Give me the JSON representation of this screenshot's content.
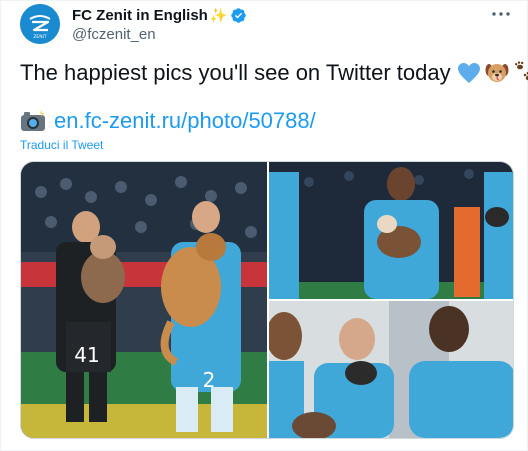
{
  "tweet": {
    "author_name": "FC Zenit in English",
    "author_handle": "@fczenit_en",
    "text": "The happiest pics you'll see on Twitter today",
    "link_text": "en.fc-zenit.ru/photo/50788/",
    "translate_label": "Traduci il Tweet"
  },
  "icons": {
    "avatar": "zenit-logo-icon",
    "name_decoration": "sparkles-icon",
    "verified": "verified-badge-icon",
    "more": "more-options-icon",
    "text_emojis": [
      "blue-heart-icon",
      "dog-face-icon",
      "paw-prints-icon"
    ],
    "link_prefix": "camera-with-flash-icon"
  },
  "colors": {
    "accent": "#1d9bf0",
    "zenit_blue": "#1a8ad1",
    "text": "#0f1419",
    "secondary": "#536471"
  },
  "media": {
    "count": 3,
    "players_numbers": [
      "41",
      "2"
    ]
  }
}
